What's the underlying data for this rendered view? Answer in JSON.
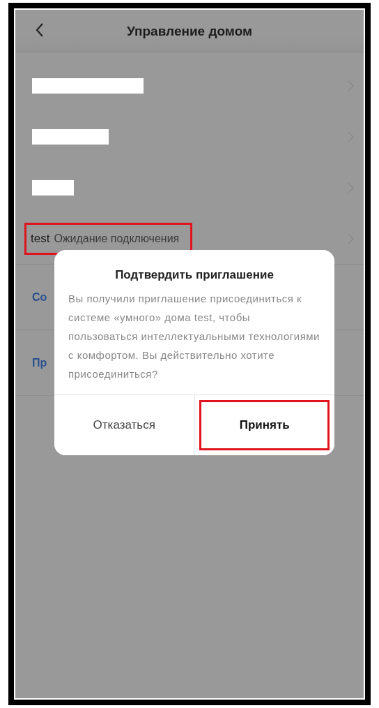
{
  "header": {
    "title": "Управление домом"
  },
  "homes": [
    {
      "kind": "redacted",
      "highlighted": false
    },
    {
      "kind": "redacted",
      "highlighted": false
    },
    {
      "kind": "redacted",
      "highlighted": false
    },
    {
      "kind": "home",
      "name": "test",
      "status": "Ожидание подключения",
      "highlighted": true
    }
  ],
  "links": [
    "Со",
    "Пр"
  ],
  "dialog": {
    "title": "Подтвердить приглашение",
    "message": "Вы получили приглашение присоединиться к системе «умного» дома test, чтобы пользоваться интеллектуальными технологиями с комфортом. Вы действительно хотите присоединиться?",
    "buttons": [
      {
        "label": "Отказаться",
        "primary": false,
        "highlighted": false
      },
      {
        "label": "Принять",
        "primary": true,
        "highlighted": true
      }
    ]
  }
}
